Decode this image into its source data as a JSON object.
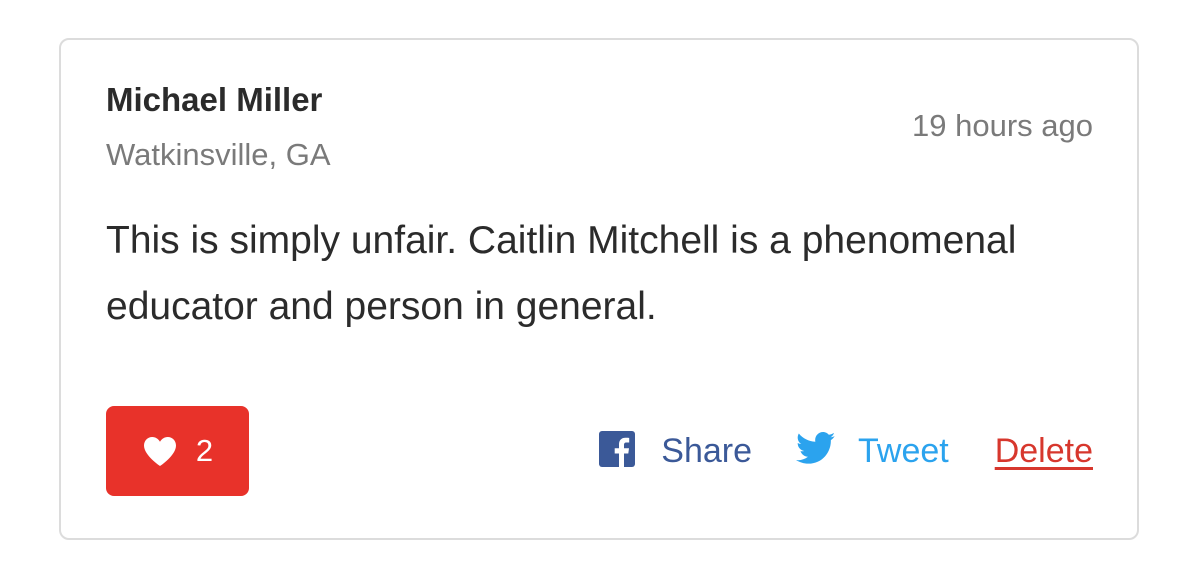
{
  "comment": {
    "author": "Michael Miller",
    "location": "Watkinsville, GA",
    "timestamp": "19 hours ago",
    "body": "This is simply unfair. Caitlin Mitchell is a phenomenal educator and person in general.",
    "likes": "2"
  },
  "actions": {
    "share_label": "Share",
    "tweet_label": "Tweet",
    "delete_label": "Delete"
  },
  "icons": {
    "like": "heart-icon",
    "share": "facebook-icon",
    "tweet": "twitter-bird-icon"
  },
  "colors": {
    "like_background": "#e8322a",
    "facebook": "#3b5998",
    "twitter": "#2ba3ee",
    "delete": "#d7372d",
    "text_primary": "#2b2b2b",
    "text_muted": "#7a7a7a",
    "card_border": "#dcdcdc"
  }
}
